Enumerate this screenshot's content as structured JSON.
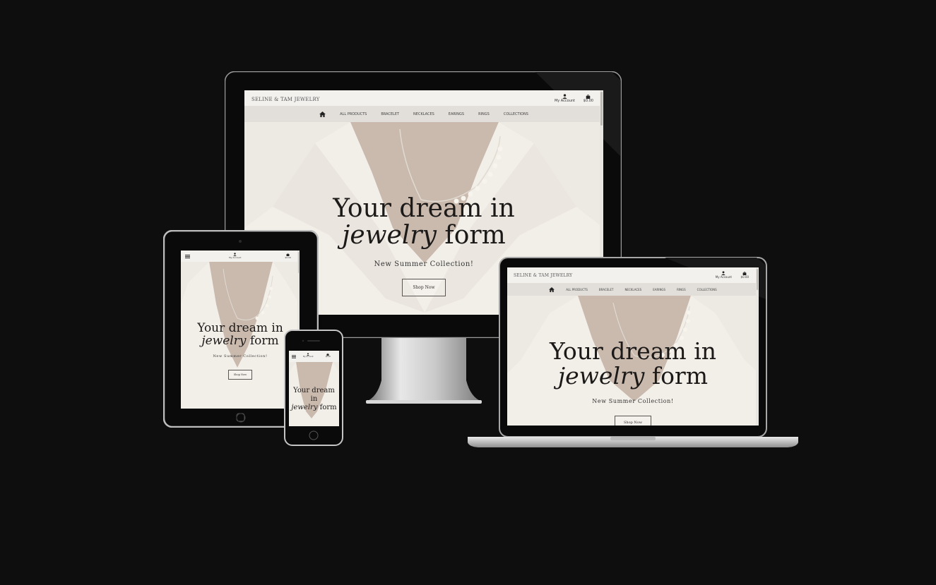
{
  "site": {
    "brand": "SELINE & TAM JEWELRY",
    "account_label": "My Account",
    "cart_total": "$0.00",
    "nav_items": [
      "ALL PRODUCTS",
      "BRACELET",
      "NECKLACES",
      "EARINGS",
      "RINGS",
      "COLLECTIONS"
    ],
    "nav_items_laptop": [
      "ALL PRODUCTS",
      "BRACELET",
      "NECKLACES",
      "EARINGS",
      "RINGS",
      "COLLECTIONS"
    ],
    "hero": {
      "line1": "Your dream in",
      "italic_word": "jewelry",
      "line2_rest": " form",
      "phone_line1": "Your dream",
      "phone_line2": "in",
      "subtitle": "New Summer Collection!",
      "cta": "Shop Now"
    }
  },
  "icons": {
    "home": "home-icon",
    "account": "user-icon",
    "cart": "shopping-bag-icon",
    "menu": "hamburger-menu-icon"
  },
  "colors": {
    "background": "#0f0e0f",
    "header": "#f3f1ee",
    "nav": "#e2dfda",
    "hero_tint": "#e8e4dd",
    "text": "#1c1a19"
  }
}
